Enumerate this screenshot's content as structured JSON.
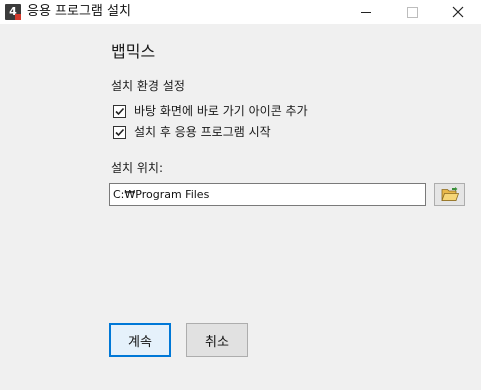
{
  "window": {
    "title": "응용 프로그램 설치",
    "app_icon_glyph": "4",
    "controls": [
      "minimize-icon",
      "maximize-icon",
      "close-icon"
    ]
  },
  "main": {
    "heading": "뱁믹스",
    "settings_label": "설치 환경 설정",
    "options": [
      {
        "label": "바탕 화면에 바로 가기 아이콘 추가",
        "checked": true
      },
      {
        "label": "설치 후 응용 프로그램 시작",
        "checked": true
      }
    ],
    "location_label": "설치 위치:",
    "location_value": "C:₩Program Files",
    "browse_icon": "folder-open-icon"
  },
  "buttons": {
    "next_label": "계속",
    "cancel_label": "취소"
  },
  "colors": {
    "accent": "#0078d7",
    "background": "#f0f0f0",
    "folder": "#e8b84a"
  }
}
